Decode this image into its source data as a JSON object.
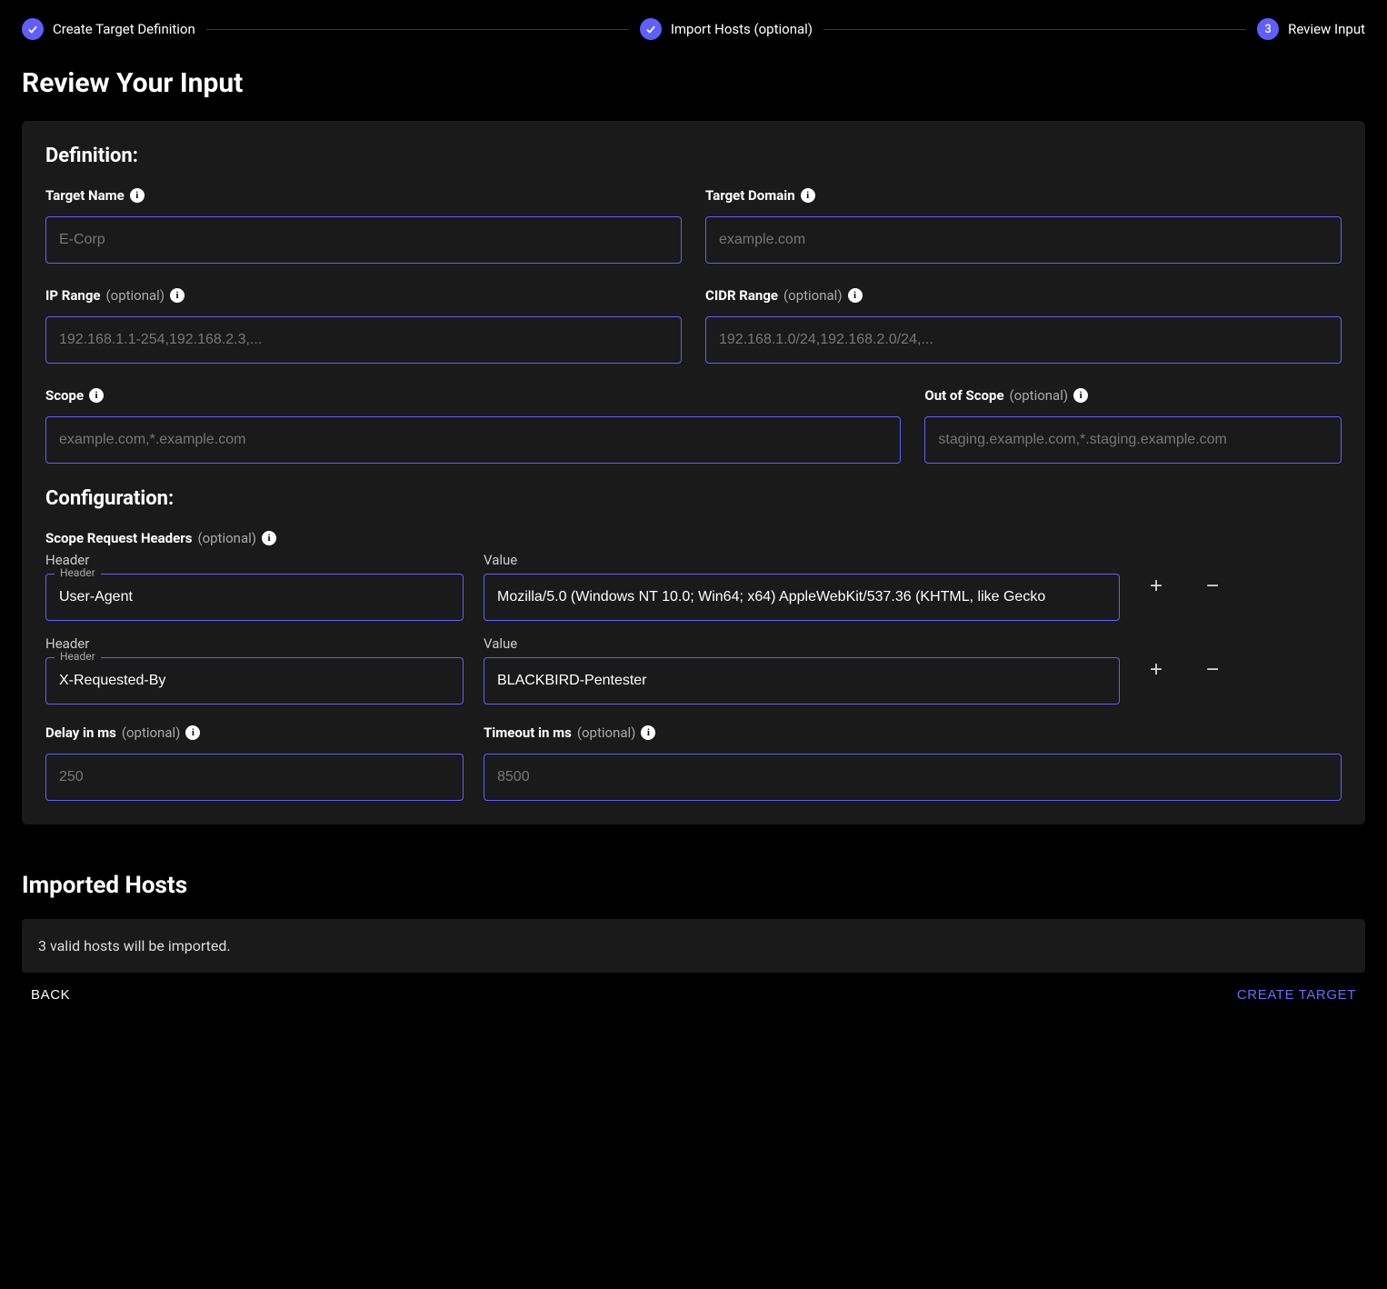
{
  "stepper": {
    "steps": [
      {
        "label": "Create Target Definition",
        "done": true
      },
      {
        "label": "Import Hosts (optional)",
        "done": true
      },
      {
        "label": "Review Input",
        "number": "3"
      }
    ]
  },
  "page_title": "Review Your Input",
  "definition": {
    "title": "Definition:",
    "target_name": {
      "label": "Target Name",
      "placeholder": "E-Corp"
    },
    "target_domain": {
      "label": "Target Domain",
      "placeholder": "example.com"
    },
    "ip_range": {
      "label": "IP Range",
      "optional": "(optional)",
      "placeholder": "192.168.1.1-254,192.168.2.3,..."
    },
    "cidr_range": {
      "label": "CIDR Range",
      "optional": "(optional)",
      "placeholder": "192.168.1.0/24,192.168.2.0/24,..."
    },
    "scope": {
      "label": "Scope",
      "placeholder": "example.com,*.example.com"
    },
    "out_of_scope": {
      "label": "Out of Scope",
      "optional": "(optional)",
      "placeholder": "staging.example.com,*.staging.example.com"
    }
  },
  "configuration": {
    "title": "Configuration:",
    "scope_headers_label": "Scope Request Headers",
    "scope_headers_optional": "(optional)",
    "col_header": "Header",
    "col_value": "Value",
    "float_header": "Header",
    "rows": [
      {
        "header": "User-Agent",
        "value": "Mozilla/5.0 (Windows NT 10.0; Win64; x64) AppleWebKit/537.36 (KHTML, like Gecko"
      },
      {
        "header": "X-Requested-By",
        "value": "BLACKBIRD-Pentester"
      }
    ],
    "delay": {
      "label": "Delay in ms",
      "optional": "(optional)",
      "placeholder": "250"
    },
    "timeout": {
      "label": "Timeout in ms",
      "optional": "(optional)",
      "placeholder": "8500"
    }
  },
  "imported": {
    "title": "Imported Hosts",
    "message": "3 valid hosts will be imported."
  },
  "actions": {
    "back": "BACK",
    "create": "CREATE TARGET"
  }
}
